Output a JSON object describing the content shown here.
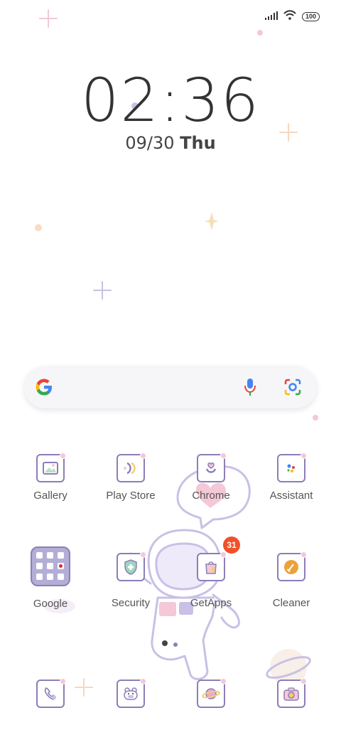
{
  "status_bar": {
    "battery": "100",
    "signal_icon": "signal-icon",
    "wifi_icon": "wifi-icon"
  },
  "clock": {
    "time": "02:36",
    "date": "09/30",
    "weekday": "Thu"
  },
  "search_bar": {
    "logo_icon": "google-g-icon",
    "mic_icon": "mic-icon",
    "lens_icon": "lens-camera-icon"
  },
  "apps_row1": [
    {
      "label": "Gallery",
      "icon": "gallery-icon"
    },
    {
      "label": "Play Store",
      "icon": "play-store-icon"
    },
    {
      "label": "Chrome",
      "icon": "chrome-icon"
    },
    {
      "label": "Assistant",
      "icon": "assistant-icon"
    }
  ],
  "apps_row2": [
    {
      "label": "Google",
      "icon": "google-folder-icon"
    },
    {
      "label": "Security",
      "icon": "security-icon"
    },
    {
      "label": "GetApps",
      "icon": "getapps-icon",
      "badge": "31"
    },
    {
      "label": "Cleaner",
      "icon": "cleaner-icon"
    }
  ],
  "dock": [
    {
      "icon": "phone-icon"
    },
    {
      "icon": "messages-icon"
    },
    {
      "icon": "browser-icon"
    },
    {
      "icon": "camera-icon"
    }
  ],
  "colors": {
    "icon_border": "#8e7db8",
    "badge": "#f0512a",
    "accent_pink": "#f4c8d6",
    "accent_lilac": "#c9c0e6"
  }
}
